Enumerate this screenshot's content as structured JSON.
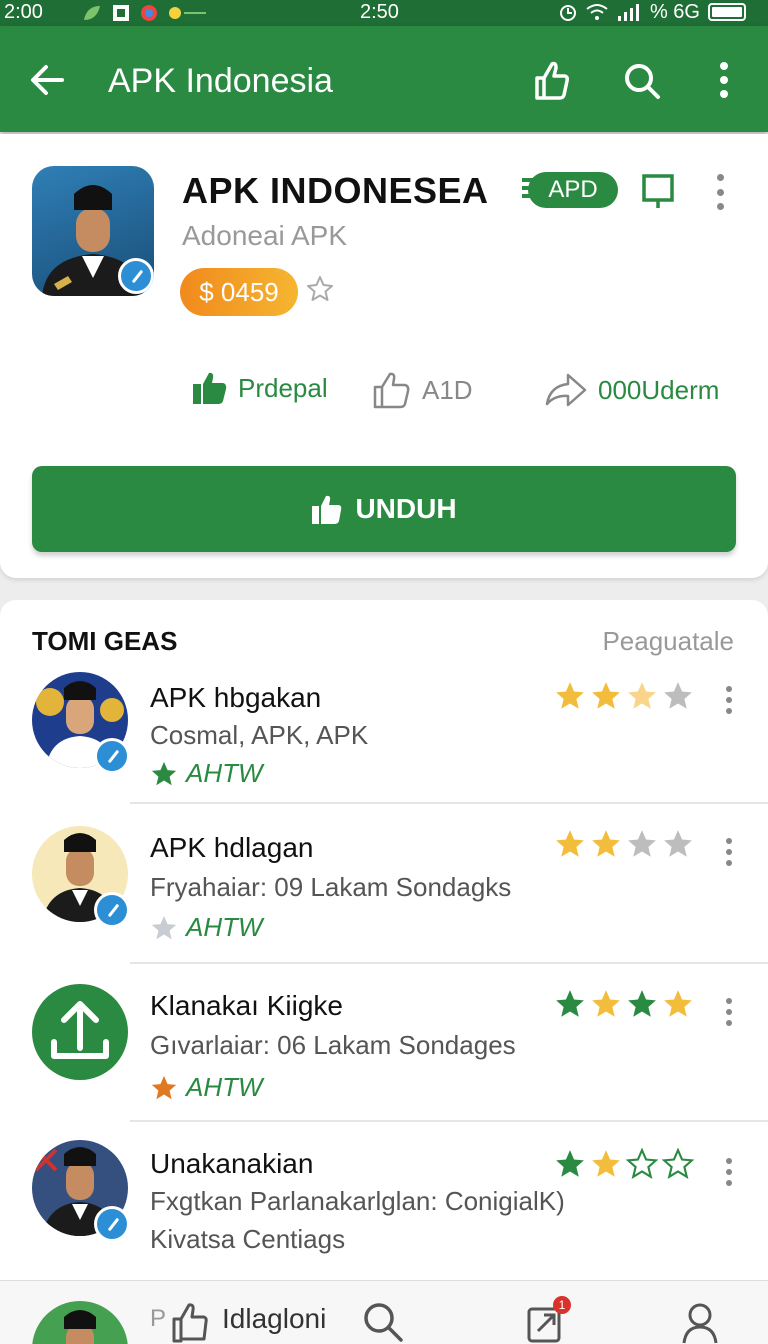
{
  "status_bar": {
    "time_left": "2:00",
    "time_center": "2:50",
    "battery_text": "% 6G"
  },
  "app_bar": {
    "title": "APK Indonesia"
  },
  "app": {
    "name": "APK INDONESEA",
    "badge": "APD",
    "developer": "Adoneai APK",
    "price": "$ 0459"
  },
  "stats": {
    "like_label": "Prdepal",
    "rate_label": "A1D",
    "share_label": "000Uderm"
  },
  "download_button": "UNDUH",
  "section": {
    "title": "TOMI GEAS",
    "link": "Peaguatale"
  },
  "list": [
    {
      "name": "APK hbgakan",
      "desc": "Cosmal, APK, APK",
      "tag": "AHTW",
      "tag_star_color": "#2a8a41",
      "rating": 2.5
    },
    {
      "name": "APK hdlagan",
      "desc": "Fryahaiar: 09 Lakam Sondagks",
      "tag": "AHTW",
      "tag_star_color": "#c8cdd4",
      "rating": 2
    },
    {
      "name": "Klanakaı Kiigke",
      "desc": "Gıvarlaiar: 06 Lakam Sondages",
      "tag": "AHTW",
      "tag_star_color": "#e07a22",
      "rating": 4
    },
    {
      "name": "Unakanakian",
      "desc": "Fxgtkan Parlanakarlglan: ConigialK)",
      "desc2": "Kivatsa Centiags",
      "rating": 2
    }
  ],
  "bottom_nav": {
    "prefix": "P",
    "label": "Idlagloni",
    "notification_count": "1"
  }
}
